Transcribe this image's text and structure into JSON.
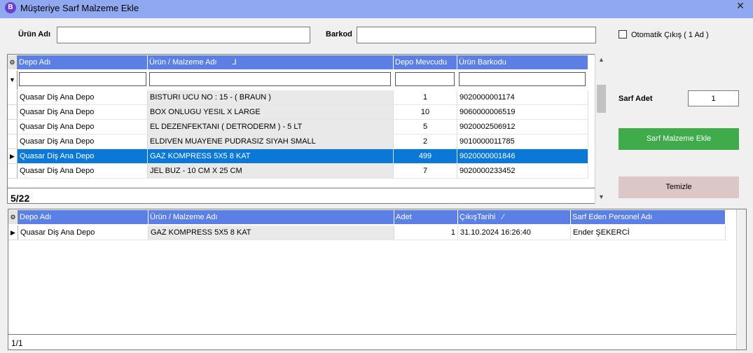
{
  "window": {
    "title": "Müşteriye Sarf Malzeme Ekle",
    "app_icon": "B",
    "close_glyph": "✕"
  },
  "search": {
    "urun_label": "Ürün Adı",
    "urun_value": "",
    "barkod_label": "Barkod",
    "barkod_value": "",
    "auto_label": "Otomatik Çıkış ( 1 Ad )"
  },
  "stock_grid": {
    "columns": [
      "Depo Adı",
      "Ürün / Malzeme Adı",
      "Depo Mevcudu",
      "Ürün Barkodu"
    ],
    "rows": [
      {
        "depo": "Quasar Diş Ana Depo",
        "urun": "BISTURI UCU NO : 15 - ( BRAUN )",
        "mevcut": "1",
        "barkod": "9020000001174"
      },
      {
        "depo": "Quasar Diş Ana Depo",
        "urun": "BOX ONLUGU YESIL X LARGE",
        "mevcut": "10",
        "barkod": "9060000006519"
      },
      {
        "depo": "Quasar Diş Ana Depo",
        "urun": "EL DEZENFEKTANI ( DETRODERM ) - 5 LT",
        "mevcut": "5",
        "barkod": "9020002506912"
      },
      {
        "depo": "Quasar Diş Ana Depo",
        "urun": "ELDIVEN MUAYENE PUDRASIZ SIYAH SMALL",
        "mevcut": "2",
        "barkod": "9010000011785"
      },
      {
        "depo": "Quasar Diş Ana Depo",
        "urun": "GAZ KOMPRESS 5X5 8 KAT",
        "mevcut": "499",
        "barkod": "9020000001846"
      },
      {
        "depo": "Quasar Diş Ana Depo",
        "urun": "JEL BUZ - 10 CM X 25 CM",
        "mevcut": "7",
        "barkod": "9020000233452"
      }
    ],
    "selected_index": 4,
    "footer": "5/22"
  },
  "right_panel": {
    "sarf_adet_label": "Sarf Adet",
    "sarf_adet_value": "1",
    "add_button": "Sarf Malzeme Ekle",
    "clear_button": "Temizle"
  },
  "consume_grid": {
    "columns": [
      "Depo Adı",
      "Ürün / Malzeme Adı",
      "Adet",
      "ÇıkışTarihi",
      "Sarf Eden Personel Adı"
    ],
    "rows": [
      {
        "depo": "Quasar Diş Ana Depo",
        "urun": "GAZ KOMPRESS 5X5 8 KAT",
        "adet": "1",
        "tarih": "31.10.2024 16:26:40",
        "personel": "Ender ŞEKERCİ"
      }
    ],
    "footer": "1/1"
  },
  "colors": {
    "header": "#5c7fe6",
    "selected": "#0a78d7",
    "add_button": "#3fab4b",
    "clear_button": "#dcc6c6",
    "titlebar": "#8fa8f0"
  }
}
